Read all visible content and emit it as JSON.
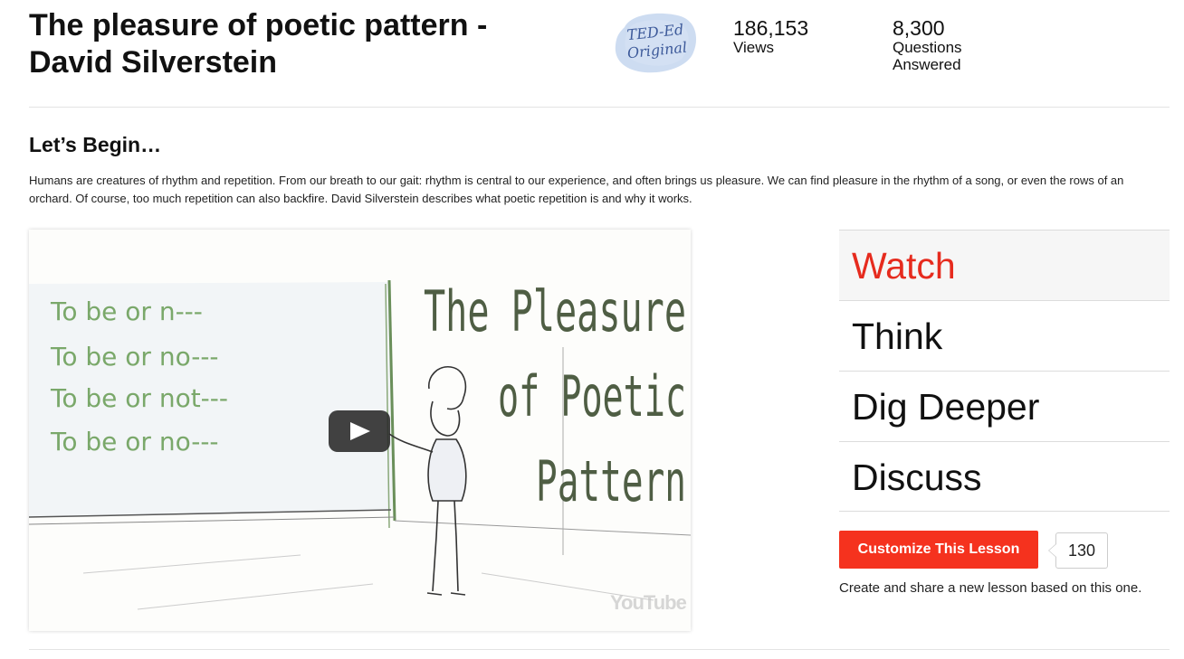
{
  "lesson": {
    "title_line1": "The pleasure of poetic pattern -",
    "title_line2": "David Silverstein",
    "badge_line1": "TED-Ed",
    "badge_line2": "Original"
  },
  "stats": {
    "views_value": "186,153",
    "views_label": "Views",
    "questions_value": "8,300",
    "questions_label1": "Questions",
    "questions_label2": "Answered"
  },
  "intro": {
    "heading": "Let’s Begin…",
    "description": "Humans are creatures of rhythm and repetition. From our breath to our gait: rhythm is central to our experience, and often brings us pleasure. We can find pleasure in the rhythm of a song, or even the rows of an orchard. Of course, too much repetition can also backfire. David Silverstein describes what poetic repetition is and why it works."
  },
  "video": {
    "title_line1": "The Pleasure",
    "title_line2": "of Poetic",
    "title_line3": "Pattern",
    "chalk_lines": [
      "To be or n---",
      "To be or no---",
      "To be or not---",
      "To be or no---"
    ],
    "watermark": "YouTube",
    "play_icon": "play-icon"
  },
  "tabs": [
    {
      "label": "Watch",
      "active": true
    },
    {
      "label": "Think",
      "active": false
    },
    {
      "label": "Dig Deeper",
      "active": false
    },
    {
      "label": "Discuss",
      "active": false
    }
  ],
  "customize": {
    "button_label": "Customize This Lesson",
    "count": "130",
    "note": "Create and share a new lesson based on this one."
  },
  "colors": {
    "accent": "#e62b1e",
    "button": "#f5321e",
    "chalk_green": "#7aa86a",
    "title_green": "#4f5e44"
  }
}
